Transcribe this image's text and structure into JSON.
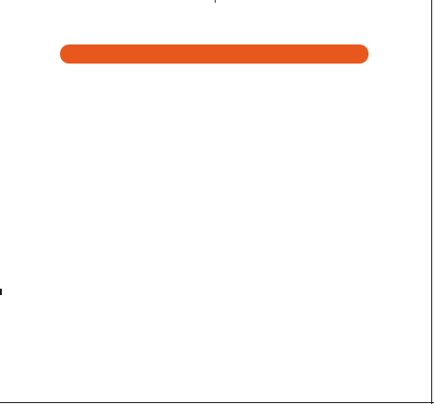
{
  "action_bar": {
    "label": "",
    "color": "#e8581c"
  }
}
